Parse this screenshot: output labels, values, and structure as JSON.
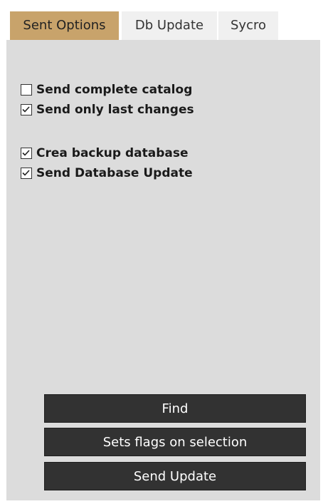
{
  "tabs": [
    {
      "label": "Sent Options",
      "active": true
    },
    {
      "label": "Db Update",
      "active": false
    },
    {
      "label": "Sycro",
      "active": false
    }
  ],
  "options": [
    {
      "label": "Send complete catalog",
      "checked": false
    },
    {
      "label": "Send only last changes",
      "checked": true
    },
    {
      "label": "Crea backup database",
      "checked": true
    },
    {
      "label": "Send Database Update",
      "checked": true
    }
  ],
  "buttons": {
    "find": "Find",
    "sets_flags": "Sets flags on selection",
    "send_update": "Send Update"
  },
  "colors": {
    "active_tab": "#c8a36b",
    "panel_bg": "#dcdcdc",
    "button_bg": "#323232"
  }
}
